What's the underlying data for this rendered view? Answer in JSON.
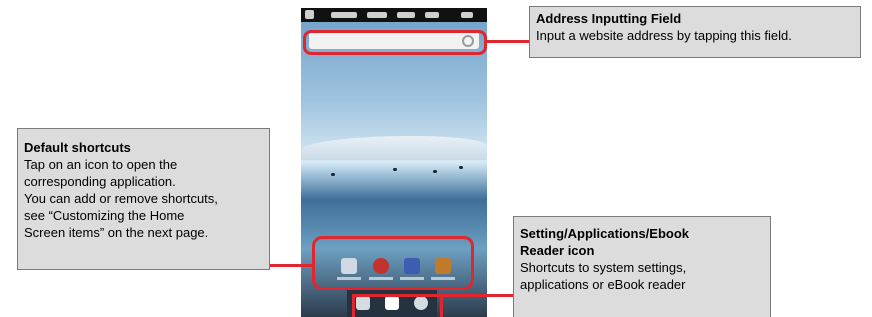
{
  "callouts": {
    "address": {
      "title": "Address Inputting Field",
      "text": "Input a website address by tapping this field."
    },
    "shortcuts": {
      "title": "Default shortcuts",
      "lines": [
        "Tap on an icon to open the",
        "corresponding application.",
        "You can add or remove shortcuts,",
        "see “Customizing the Home",
        "Screen items” on the next page."
      ]
    },
    "settings": {
      "title_lines": [
        "Setting/Applications/Ebook",
        "Reader icon"
      ],
      "lines": [
        "Shortcuts to system settings,",
        "applications or eBook reader"
      ]
    }
  },
  "colors": {
    "highlight": "#e0262e",
    "callout_bg": "#dcdcdc"
  },
  "icons": [
    "home-icon",
    "back-icon",
    "search-icon",
    "browser-icon",
    "music-icon",
    "video-icon",
    "gallery-icon",
    "ebook-icon",
    "apps-grid-icon",
    "settings-icon"
  ]
}
